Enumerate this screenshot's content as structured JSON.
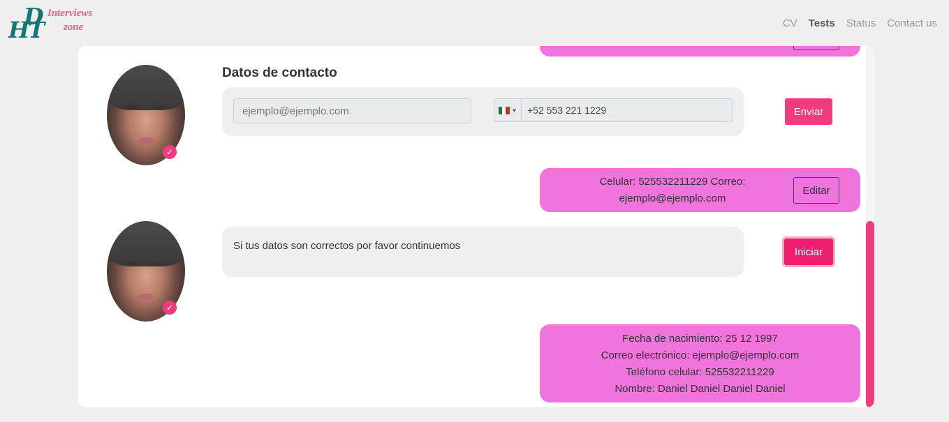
{
  "logo": {
    "letters_top": "D",
    "letters_bottom": "HT",
    "word1": "Interviews",
    "word2": "zone"
  },
  "nav": {
    "items": [
      {
        "label": "CV"
      },
      {
        "label": "Tests"
      },
      {
        "label": "Status"
      },
      {
        "label": "Contact us"
      }
    ],
    "active": "Tests"
  },
  "contact_form": {
    "title": "Datos de contacto",
    "email_placeholder": "ejemplo@ejemplo.com",
    "phone_value": "+52 553 221 1229",
    "send_label": "Enviar"
  },
  "contact_reply": {
    "text": "Celular: 525532211229 Correo: ejemplo@ejemplo.com",
    "edit_label": "Editar"
  },
  "confirm": {
    "text": "Si tus datos son correctos por favor continuemos",
    "start_label": "Iniciar"
  },
  "summary": {
    "lines": [
      "Fecha de nacimiento: 25 12 1997",
      "Correo electrónico: ejemplo@ejemplo.com",
      "Teléfono celular: 525532211229",
      "Nombre: Daniel Daniel Daniel Daniel"
    ]
  },
  "colors": {
    "accent": "#f23a7f",
    "bubble_pink": "#ef74dc",
    "logo_teal": "#0f7a73"
  },
  "badge_glyph": "✓"
}
